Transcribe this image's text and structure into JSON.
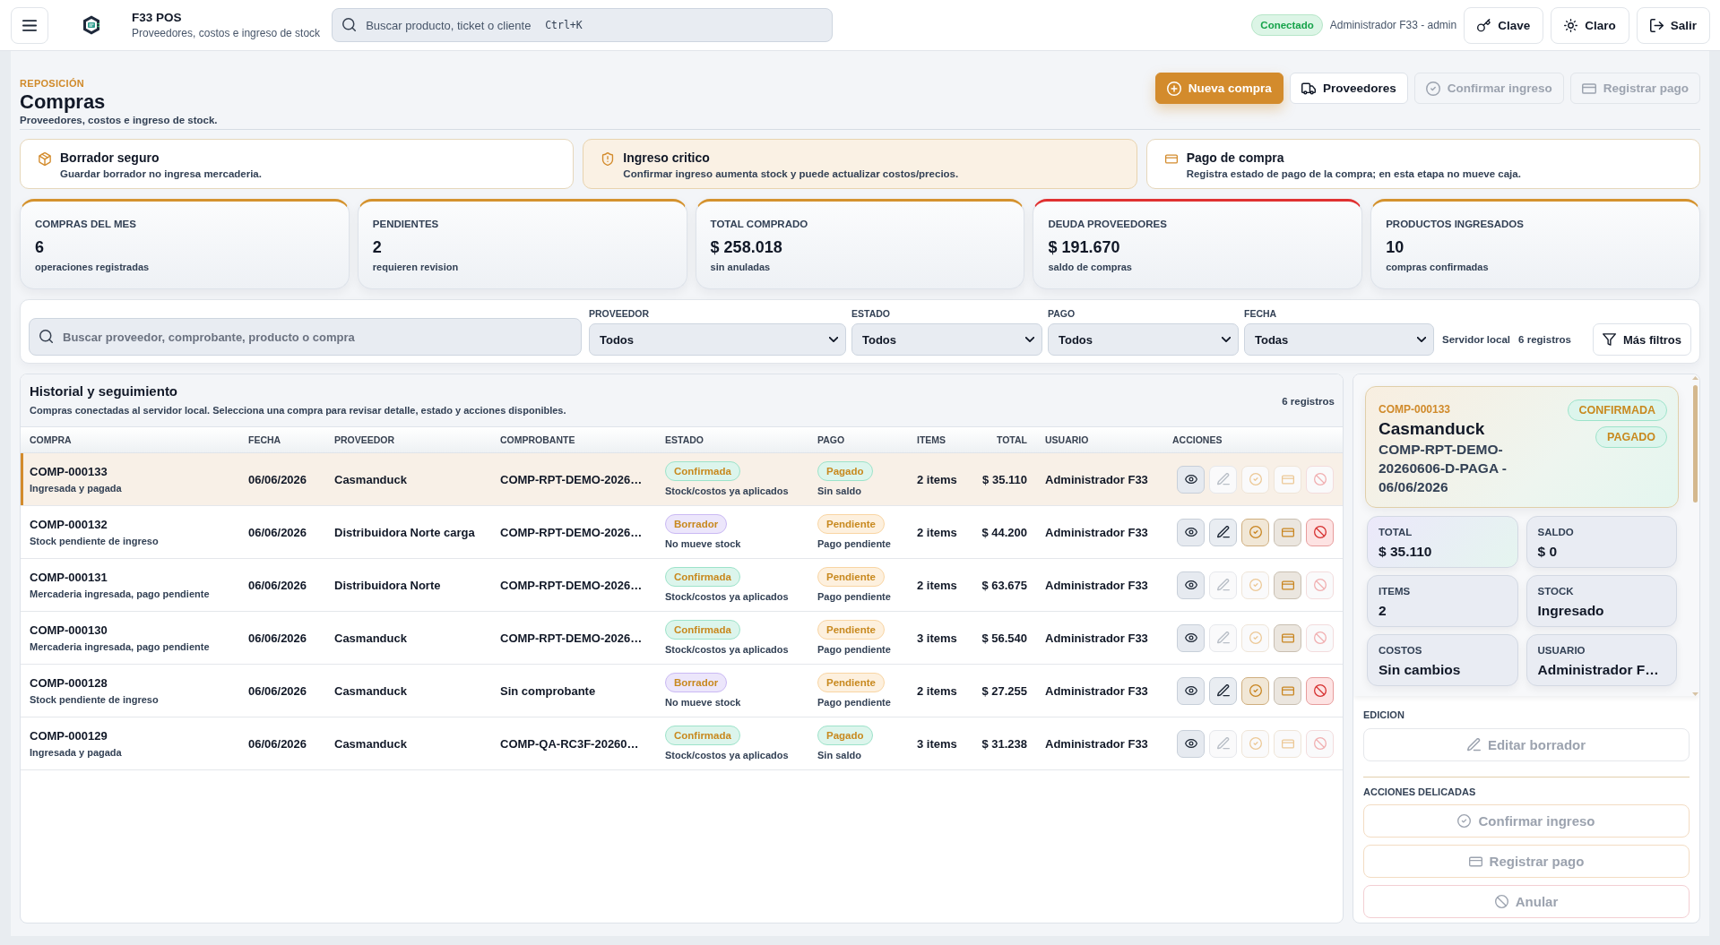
{
  "topbar": {
    "app_title": "F33 POS",
    "app_subtitle": "Proveedores, costos e ingreso de stock",
    "search": {
      "placeholder": "Buscar producto, ticket o cliente",
      "shortcut": "Ctrl+K"
    },
    "connection_badge": "Conectado",
    "user": "Administrador F33 - admin",
    "buttons": [
      "Clave",
      "Claro",
      "Salir"
    ]
  },
  "page_header": {
    "eyebrow": "REPOSICIÓN",
    "title": "Compras",
    "subtitle": "Proveedores, costos e ingreso de stock.",
    "actions": [
      {
        "label": "Nueva compra",
        "kind": "primary",
        "disabled": false
      },
      {
        "label": "Proveedores",
        "kind": "secondary",
        "disabled": false
      },
      {
        "label": "Confirmar ingreso",
        "kind": "secondary",
        "disabled": true
      },
      {
        "label": "Registrar pago",
        "kind": "secondary",
        "disabled": true
      }
    ]
  },
  "notices": [
    {
      "title": "Borrador seguro",
      "text": "Guardar borrador no ingresa mercaderia.",
      "kind": "info"
    },
    {
      "title": "Ingreso critico",
      "text": "Confirmar ingreso aumenta stock y puede actualizar costos/precios.",
      "kind": "warning"
    },
    {
      "title": "Pago de compra",
      "text": "Registra estado de pago de la compra; en esta etapa no mueve caja.",
      "kind": "info"
    }
  ],
  "kpis": [
    {
      "label": "COMPRAS DEL MES",
      "value": "6",
      "note": "operaciones registradas",
      "color": "#d4922e"
    },
    {
      "label": "PENDIENTES",
      "value": "2",
      "note": "requieren revision",
      "color": "#d4922e"
    },
    {
      "label": "TOTAL COMPRADO",
      "value": "$ 258.018",
      "note": "sin anuladas",
      "color": "#d4922e"
    },
    {
      "label": "DEUDA PROVEEDORES",
      "value": "$ 191.670",
      "note": "saldo de compras",
      "color": "#e03131"
    },
    {
      "label": "PRODUCTOS INGRESADOS",
      "value": "10",
      "note": "compras confirmadas",
      "color": "#d4922e"
    }
  ],
  "filters": {
    "search": {
      "placeholder": "Buscar proveedor, comprobante, producto o compra"
    },
    "selects": [
      {
        "label": "PROVEEDOR",
        "value": "Todos"
      },
      {
        "label": "ESTADO",
        "value": "Todos"
      },
      {
        "label": "PAGO",
        "value": "Todos"
      },
      {
        "label": "FECHA",
        "value": "Todas"
      }
    ],
    "source": "Servidor local",
    "count": "6 registros",
    "more_button": "Más filtros"
  },
  "history": {
    "title": "Historial y seguimiento",
    "description": "Compras conectadas al servidor local. Selecciona una compra para revisar detalle, estado y acciones disponibles.",
    "count": "6 registros",
    "table": {
      "columns": [
        "COMPRA",
        "FECHA",
        "PROVEEDOR",
        "COMPROBANTE",
        "ESTADO",
        "PAGO",
        "ITEMS",
        "TOTAL",
        "USUARIO",
        "ACCIONES"
      ],
      "rows": [
        {
          "selected": true,
          "id": "COMP-000133",
          "summary": "Ingresada y pagada",
          "date": "06/06/2026",
          "supplier": "Casmanduck",
          "voucher": "COMP-RPT-DEMO-2026…",
          "status": {
            "label": "Confirmada",
            "color": "#dcf5ec",
            "note": "Stock/costos ya aplicados"
          },
          "payment": {
            "label": "Pagado",
            "color": "#dcf5ec",
            "note": "Sin saldo"
          },
          "items": "2 items",
          "total": "$ 35.110",
          "user": "Administrador F33",
          "actions": [
            {
              "kind": "view",
              "disabled": false
            },
            {
              "kind": "edit",
              "disabled": true
            },
            {
              "kind": "confirm",
              "disabled": true
            },
            {
              "kind": "pay",
              "disabled": true
            },
            {
              "kind": "void",
              "disabled": true
            }
          ]
        },
        {
          "selected": false,
          "id": "COMP-000132",
          "summary": "Stock pendiente de ingreso",
          "date": "06/06/2026",
          "supplier": "Distribuidora Norte carga",
          "voucher": "COMP-RPT-DEMO-2026…",
          "status": {
            "label": "Borrador",
            "color": "#ece6fb",
            "note": "No mueve stock"
          },
          "payment": {
            "label": "Pendiente",
            "color": "#fdf0de",
            "note": "Pago pendiente"
          },
          "items": "2 items",
          "total": "$ 44.200",
          "user": "Administrador F33",
          "actions": [
            {
              "kind": "view",
              "disabled": false
            },
            {
              "kind": "edit",
              "disabled": false
            },
            {
              "kind": "confirm",
              "disabled": false
            },
            {
              "kind": "pay",
              "disabled": false
            },
            {
              "kind": "void",
              "disabled": false
            }
          ]
        },
        {
          "selected": false,
          "id": "COMP-000131",
          "summary": "Mercaderia ingresada, pago pendiente",
          "date": "06/06/2026",
          "supplier": "Distribuidora Norte",
          "voucher": "COMP-RPT-DEMO-2026…",
          "status": {
            "label": "Confirmada",
            "color": "#dcf5ec",
            "note": "Stock/costos ya aplicados"
          },
          "payment": {
            "label": "Pendiente",
            "color": "#fdf0de",
            "note": "Pago pendiente"
          },
          "items": "2 items",
          "total": "$ 63.675",
          "user": "Administrador F33",
          "actions": [
            {
              "kind": "view",
              "disabled": false
            },
            {
              "kind": "edit",
              "disabled": true
            },
            {
              "kind": "confirm",
              "disabled": true
            },
            {
              "kind": "pay",
              "disabled": false
            },
            {
              "kind": "void",
              "disabled": true
            }
          ]
        },
        {
          "selected": false,
          "id": "COMP-000130",
          "summary": "Mercaderia ingresada, pago pendiente",
          "date": "06/06/2026",
          "supplier": "Casmanduck",
          "voucher": "COMP-RPT-DEMO-2026…",
          "status": {
            "label": "Confirmada",
            "color": "#dcf5ec",
            "note": "Stock/costos ya aplicados"
          },
          "payment": {
            "label": "Pendiente",
            "color": "#fdf0de",
            "note": "Pago pendiente"
          },
          "items": "3 items",
          "total": "$ 56.540",
          "user": "Administrador F33",
          "actions": [
            {
              "kind": "view",
              "disabled": false
            },
            {
              "kind": "edit",
              "disabled": true
            },
            {
              "kind": "confirm",
              "disabled": true
            },
            {
              "kind": "pay",
              "disabled": false
            },
            {
              "kind": "void",
              "disabled": true
            }
          ]
        },
        {
          "selected": false,
          "id": "COMP-000128",
          "summary": "Stock pendiente de ingreso",
          "date": "06/06/2026",
          "supplier": "Casmanduck",
          "voucher": "Sin comprobante",
          "status": {
            "label": "Borrador",
            "color": "#ece6fb",
            "note": "No mueve stock"
          },
          "payment": {
            "label": "Pendiente",
            "color": "#fdf0de",
            "note": "Pago pendiente"
          },
          "items": "2 items",
          "total": "$ 27.255",
          "user": "Administrador F33",
          "actions": [
            {
              "kind": "view",
              "disabled": false
            },
            {
              "kind": "edit",
              "disabled": false
            },
            {
              "kind": "confirm",
              "disabled": false
            },
            {
              "kind": "pay",
              "disabled": false
            },
            {
              "kind": "void",
              "disabled": false
            }
          ]
        },
        {
          "selected": false,
          "id": "COMP-000129",
          "summary": "Ingresada y pagada",
          "date": "06/06/2026",
          "supplier": "Casmanduck",
          "voucher": "COMP-QA-RC3F-20260…",
          "status": {
            "label": "Confirmada",
            "color": "#dcf5ec",
            "note": "Stock/costos ya aplicados"
          },
          "payment": {
            "label": "Pagado",
            "color": "#dcf5ec",
            "note": "Sin saldo"
          },
          "items": "3 items",
          "total": "$ 31.238",
          "user": "Administrador F33",
          "actions": [
            {
              "kind": "view",
              "disabled": false
            },
            {
              "kind": "edit",
              "disabled": true
            },
            {
              "kind": "confirm",
              "disabled": true
            },
            {
              "kind": "pay",
              "disabled": true
            },
            {
              "kind": "void",
              "disabled": true
            }
          ]
        }
      ]
    }
  },
  "detail": {
    "id": "COMP-000133",
    "supplier": "Casmanduck",
    "reference": "COMP-RPT-DEMO-20260606-D-PAGA - 06/06/2026",
    "badges": [
      {
        "label": "CONFIRMADA",
        "color": "#dcf5ec"
      },
      {
        "label": "PAGADO",
        "color": "#dcf5ec"
      }
    ],
    "stats": [
      {
        "label": "TOTAL",
        "value": "$ 35.110",
        "kind": "accent"
      },
      {
        "label": "SALDO",
        "value": "$ 0",
        "kind": "plain"
      },
      {
        "label": "ITEMS",
        "value": "2",
        "kind": "plain"
      },
      {
        "label": "STOCK",
        "value": "Ingresado",
        "kind": "plain"
      },
      {
        "label": "COSTOS",
        "value": "Sin cambios",
        "kind": "plain"
      },
      {
        "label": "USUARIO",
        "value": "Administrador F…",
        "kind": "plain"
      }
    ],
    "sections": [
      {
        "title": "EDICION",
        "buttons": [
          {
            "label": "Editar borrador",
            "kind": "edit",
            "disabled": true
          }
        ]
      },
      {
        "title": "ACCIONES DELICADAS",
        "buttons": [
          {
            "label": "Confirmar ingreso",
            "kind": "confirm",
            "disabled": true
          },
          {
            "label": "Registrar pago",
            "kind": "pay",
            "disabled": true
          },
          {
            "label": "Anular",
            "kind": "void",
            "disabled": true
          }
        ]
      }
    ]
  }
}
